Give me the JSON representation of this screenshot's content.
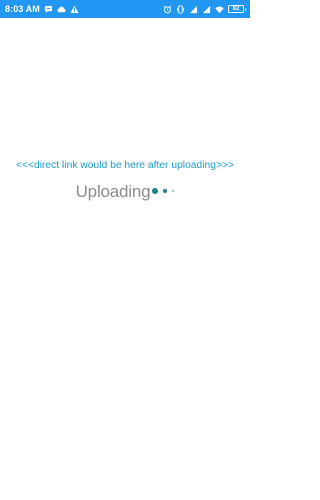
{
  "status_bar": {
    "time": "8:03 AM",
    "battery": "82",
    "color": "#2196f3",
    "left_icons": [
      "chat-icon",
      "cloud-icon",
      "warning-icon"
    ],
    "right_icons": [
      "alarm-icon",
      "vibrate-icon",
      "signal-icon",
      "signal-icon",
      "wifi-icon",
      "battery-icon"
    ]
  },
  "main": {
    "direct_link_text": "<<<direct link would be here after uploading>>>",
    "uploading_label": "Uploading",
    "link_color": "#1e9bd7",
    "progress_dot_color": "#1a7f86"
  }
}
